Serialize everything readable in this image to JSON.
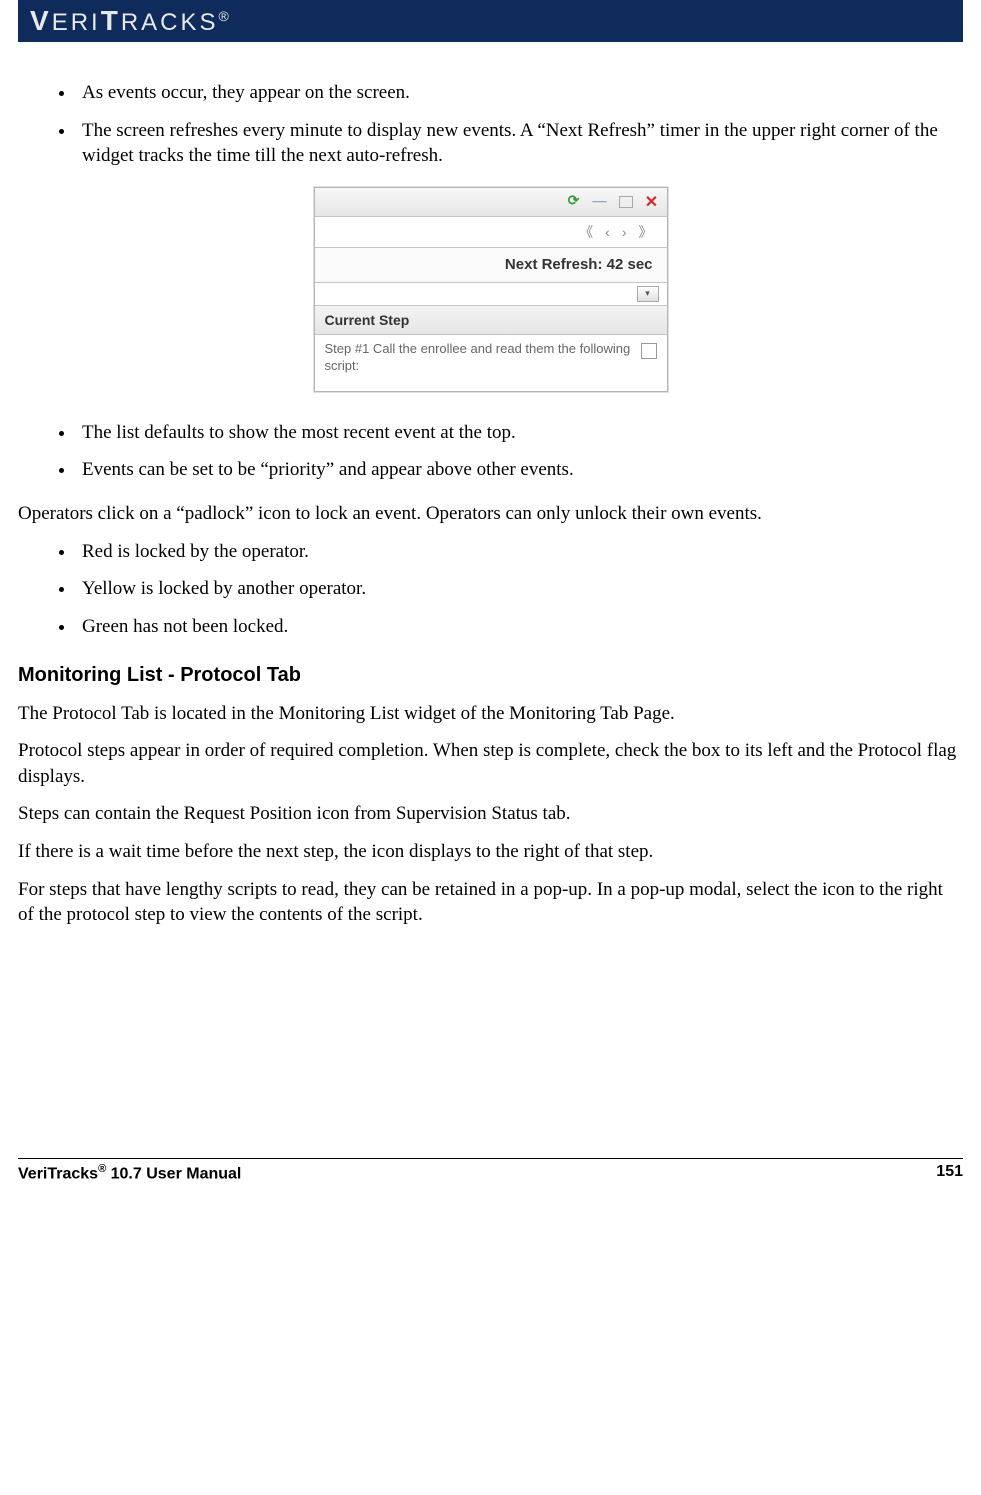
{
  "header": {
    "brand_html": "VERITRACKS®"
  },
  "bullets_top": [
    "As events occur, they appear on the screen.",
    "The screen refreshes every minute to display new events.  A “Next Refresh” timer in the upper right corner of the widget tracks the time till the next auto-refresh."
  ],
  "widget": {
    "nav_first": "《",
    "nav_prev": "‹",
    "nav_next": "›",
    "nav_last": "》",
    "refresh_label": "Next Refresh: 42 sec",
    "section_head": "Current Step",
    "step_text": "Step #1 Call the enrollee and read them the following script:"
  },
  "bullets_mid": [
    "The list defaults to show the most recent event at the top.",
    "Events can be set to be “priority” and appear above other events."
  ],
  "padlock_para": "Operators click on a “padlock” icon to lock an event.  Operators can only unlock their own events.",
  "bullets_locks": [
    "Red is locked by the operator.",
    "Yellow is locked by another operator.",
    "Green has not been locked."
  ],
  "section_heading": "Monitoring List - Protocol Tab",
  "paras": [
    "The Protocol Tab is located in the Monitoring List widget of the Monitoring Tab Page.",
    "Protocol steps appear in order of required completion.  When  step is complete, check the box to its left and the Protocol flag displays.",
    "Steps can contain the Request Position icon from Supervision Status tab.",
    "If there is a wait time before the next step, the icon displays to the right of that step.",
    "For steps that have lengthy scripts to read, they can be retained in a pop-up.  In a pop-up modal, select the icon to the right of the protocol step to view the contents of the script."
  ],
  "footer": {
    "left": "VeriTracks® 10.7 User Manual",
    "right": "151"
  }
}
